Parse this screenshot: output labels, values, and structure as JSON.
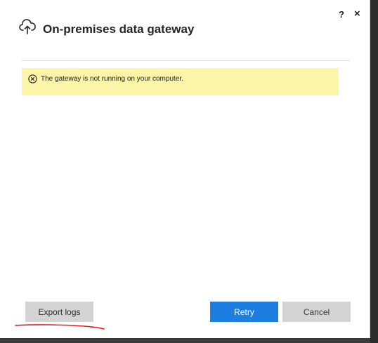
{
  "dialog": {
    "title": "On-premises data gateway",
    "title_icon": "cloud-upload-icon",
    "help_label": "?",
    "close_label": "×"
  },
  "banner": {
    "icon": "error-circle-x-icon",
    "message": "The gateway is not running on your computer.",
    "background_color": "#fcf4a6"
  },
  "footer": {
    "export_logs_label": "Export logs",
    "retry_label": "Retry",
    "cancel_label": "Cancel"
  },
  "colors": {
    "accent": "#1b7ee0",
    "annotation": "#e0201c"
  }
}
